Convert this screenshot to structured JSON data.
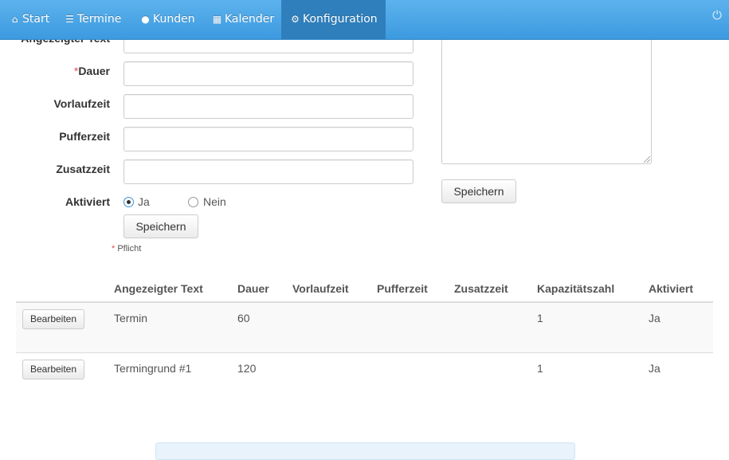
{
  "nav": {
    "items": [
      {
        "label": "Start",
        "icon": "home-icon"
      },
      {
        "label": "Termine",
        "icon": "list-icon"
      },
      {
        "label": "Kunden",
        "icon": "user-icon"
      },
      {
        "label": "Kalender",
        "icon": "calendar-icon"
      },
      {
        "label": "Konfiguration",
        "icon": "cogs-icon"
      }
    ],
    "active": "Konfiguration",
    "power_icon": "power-icon"
  },
  "form": {
    "label_text": "Angezeigter Text",
    "label_dauer": "Dauer",
    "label_vorlauf": "Vorlaufzeit",
    "label_puffer": "Pufferzeit",
    "label_zusatz": "Zusatzzeit",
    "label_aktiviert": "Aktiviert",
    "required_marker": "*",
    "radio_ja": "Ja",
    "radio_nein": "Nein",
    "selected": "Ja",
    "save_label": "Speichern",
    "pflicht": "Pflicht",
    "right_save_label": "Speichern"
  },
  "table": {
    "headers": [
      "Angezeigter Text",
      "Dauer",
      "Vorlaufzeit",
      "Pufferzeit",
      "Zusatzzeit",
      "Kapazitätszahl",
      "Aktiviert"
    ],
    "edit_label": "Bearbeiten",
    "rows": [
      {
        "text": "Termin",
        "dauer": "60",
        "vorlauf": "",
        "puffer": "",
        "zusatz": "",
        "kapazitaet": "1",
        "aktiviert": "Ja"
      },
      {
        "text": "Termingrund #1",
        "dauer": "120",
        "vorlauf": "",
        "puffer": "",
        "zusatz": "",
        "kapazitaet": "1",
        "aktiviert": "Ja"
      }
    ]
  },
  "colors": {
    "navbar": "#4aa3e6",
    "active_nav": "#2f7fbd",
    "required": "#d9534f"
  }
}
